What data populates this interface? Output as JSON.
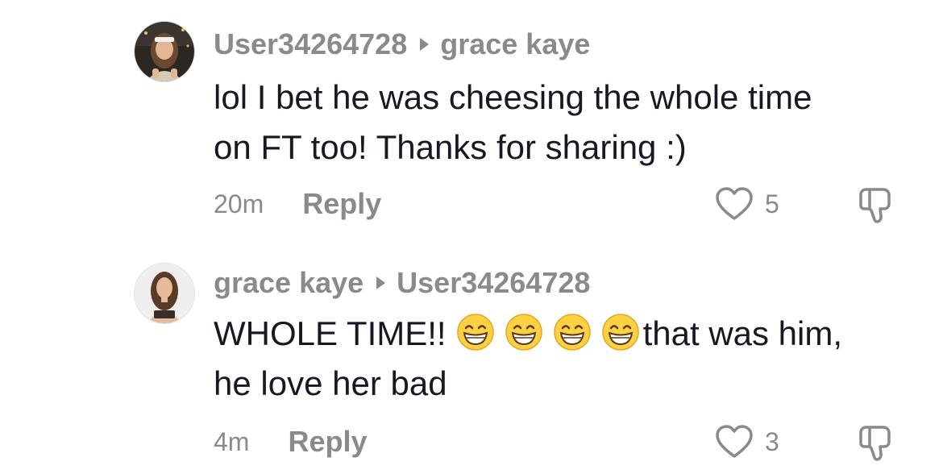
{
  "comments": [
    {
      "author": "User34264728",
      "reply_to": "grace kaye",
      "text_line1": "lol I bet he was cheesing the whole time",
      "text_line2": "on FT too! Thanks for sharing :)",
      "time": "20m",
      "reply_label": "Reply",
      "likes": "5"
    },
    {
      "author": "grace kaye",
      "reply_to": "User34264728",
      "text_part1": "WHOLE TIME!!",
      "text_part2": "that was him,",
      "text_line2": "he love her bad",
      "time": "4m",
      "reply_label": "Reply",
      "likes": "3"
    }
  ],
  "colors": {
    "meta_gray": "#8a8a8a",
    "text": "#161823"
  },
  "icons": [
    "heart-outline-icon",
    "dislike-icon",
    "grinning-face-emoji"
  ]
}
